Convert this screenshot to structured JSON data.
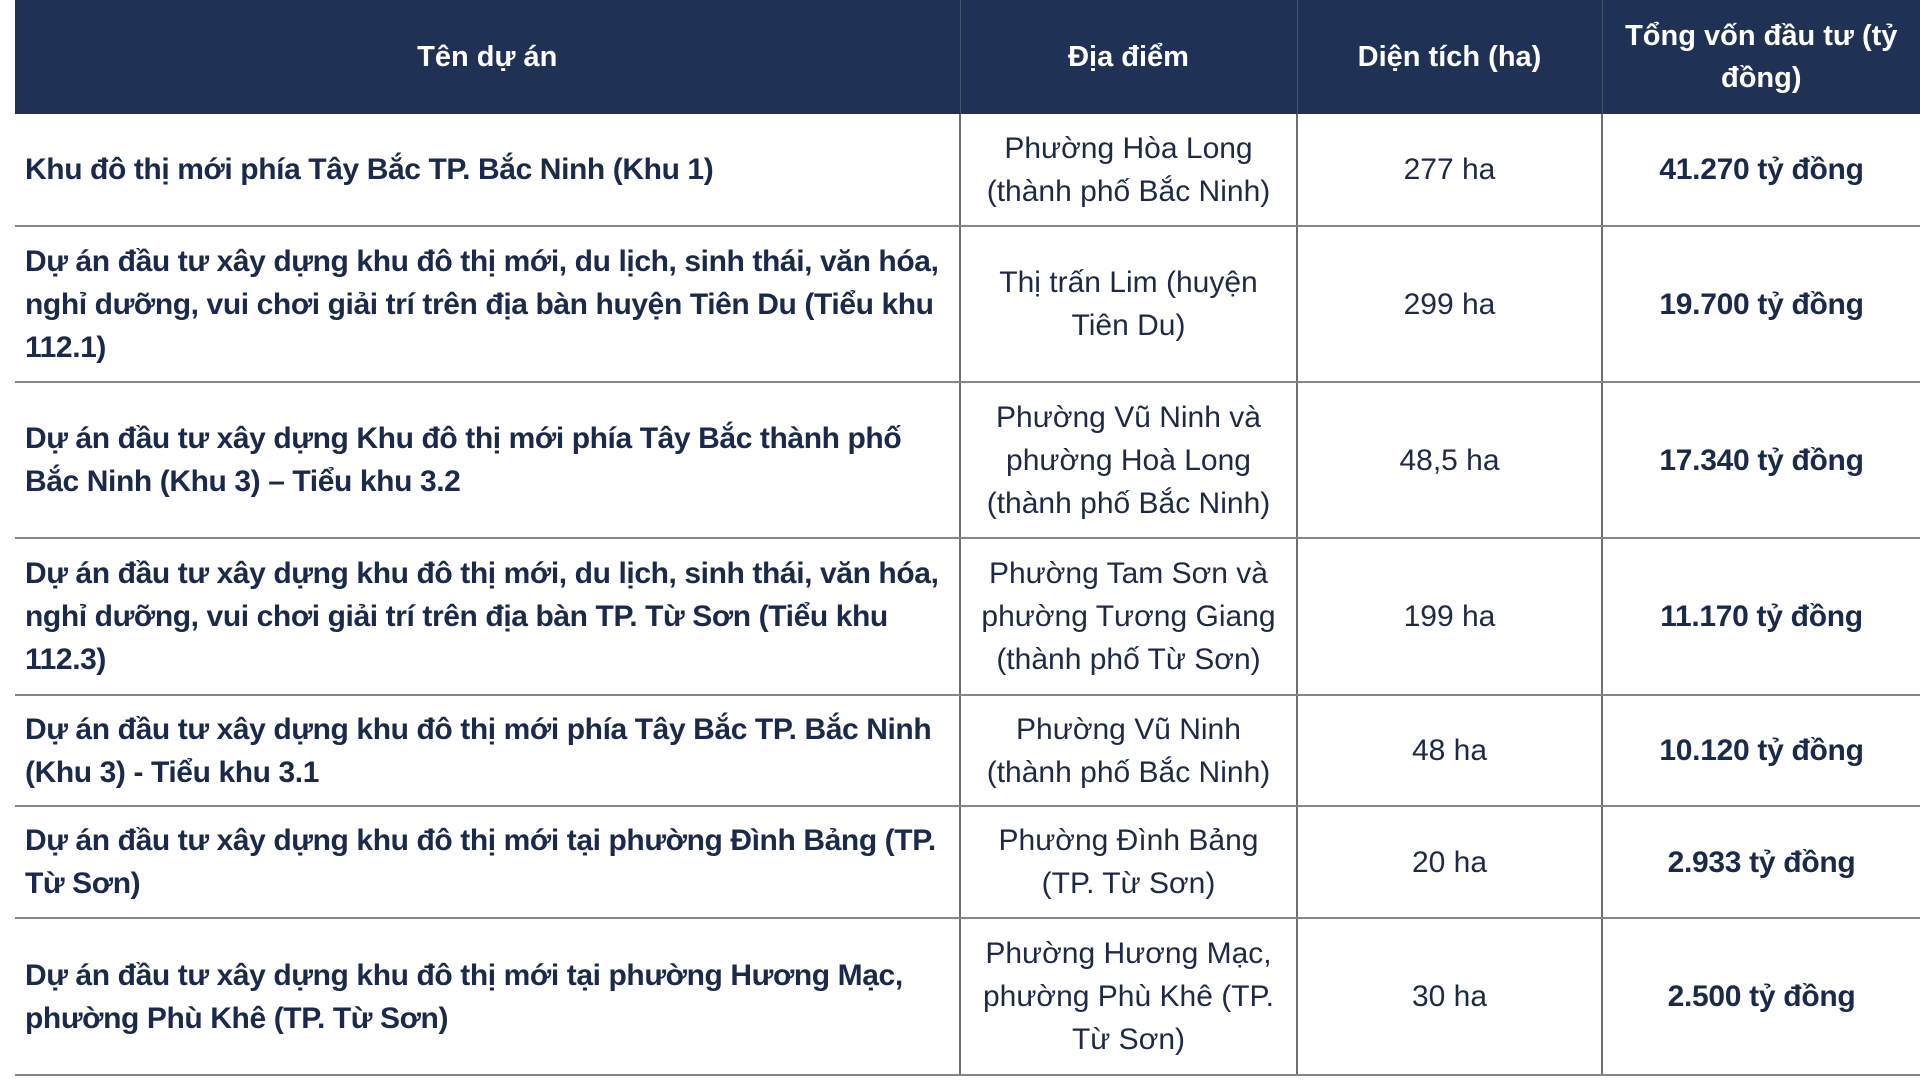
{
  "table": {
    "headers": {
      "name": "Tên dự án",
      "location": "Địa điểm",
      "area": "Diện tích (ha)",
      "capital": "Tổng vốn đầu tư (tỷ đồng)"
    },
    "rows": [
      {
        "name": "Khu đô thị mới phía Tây Bắc TP. Bắc Ninh (Khu 1)",
        "location": "Phường Hòa Long (thành phố Bắc Ninh)",
        "area": "277 ha",
        "capital": "41.270 tỷ đồng"
      },
      {
        "name": "Dự án đầu tư xây dựng khu đô thị mới, du lịch, sinh thái, văn hóa, nghỉ dưỡng, vui chơi giải trí trên địa bàn huyện Tiên Du (Tiểu khu 112.1)",
        "location": "Thị trấn Lim (huyện Tiên Du)",
        "area": "299 ha",
        "capital": "19.700 tỷ đồng"
      },
      {
        "name": "Dự án đầu tư xây dựng Khu đô thị mới phía Tây Bắc thành phố Bắc Ninh (Khu 3) – Tiểu khu 3.2",
        "location": "Phường Vũ Ninh và phường Hoà Long (thành phố Bắc Ninh)",
        "area": "48,5 ha",
        "capital": "17.340 tỷ đồng"
      },
      {
        "name": "Dự án đầu tư xây dựng khu đô thị mới, du lịch, sinh thái, văn hóa, nghỉ dưỡng, vui chơi giải trí trên địa bàn TP. Từ Sơn (Tiểu khu 112.3)",
        "location": "Phường Tam Sơn và phường Tương Giang (thành phố Từ Sơn)",
        "area": "199 ha",
        "capital": "11.170 tỷ đồng"
      },
      {
        "name": "Dự án đầu tư xây dựng khu đô thị mới phía Tây Bắc TP. Bắc Ninh (Khu 3) - Tiểu khu 3.1",
        "location": "Phường Vũ Ninh (thành phố Bắc Ninh)",
        "area": "48 ha",
        "capital": "10.120 tỷ đồng"
      },
      {
        "name": "Dự án đầu tư xây dựng khu đô thị mới tại phường Đình Bảng (TP. Từ Sơn)",
        "location": "Phường Đình Bảng (TP. Từ Sơn)",
        "area": "20 ha",
        "capital": "2.933 tỷ đồng"
      },
      {
        "name": "Dự án đầu tư xây dựng khu đô thị mới tại phường Hương Mạc, phường Phù Khê (TP. Từ Sơn)",
        "location": "Phường Hương Mạc, phường Phù Khê (TP. Từ Sơn)",
        "area": "30 ha",
        "capital": "2.500 tỷ đồng"
      }
    ]
  },
  "colors": {
    "header_bg": "#1f3154",
    "header_text": "#ffffff",
    "body_text": "#1b2a4a",
    "grid": "#858585"
  }
}
